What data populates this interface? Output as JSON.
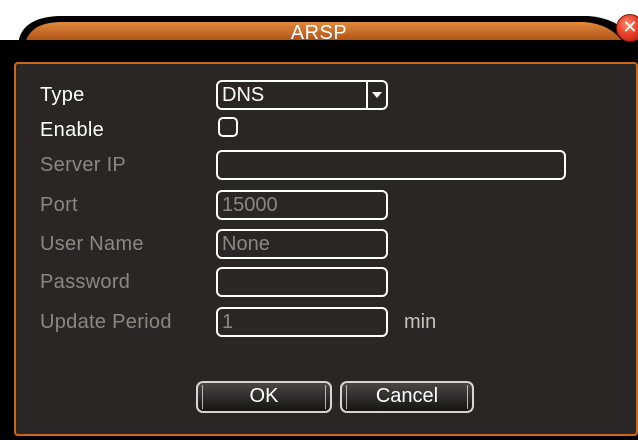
{
  "dialog": {
    "title": "ARSP",
    "close_icon": "close-icon",
    "colors": {
      "accent": "#c9671d",
      "panel": "#2a2625",
      "active_text": "#ffffff",
      "disabled_text": "#8b8784"
    }
  },
  "form": {
    "type": {
      "label": "Type",
      "value": "DNS"
    },
    "enable": {
      "label": "Enable",
      "checked": false
    },
    "server_ip": {
      "label": "Server IP",
      "value": ""
    },
    "port": {
      "label": "Port",
      "value": "15000"
    },
    "user_name": {
      "label": "User Name",
      "value": "None"
    },
    "password": {
      "label": "Password",
      "value": ""
    },
    "update_period": {
      "label": "Update Period",
      "value": "1",
      "unit": "min"
    }
  },
  "buttons": {
    "ok": "OK",
    "cancel": "Cancel"
  }
}
